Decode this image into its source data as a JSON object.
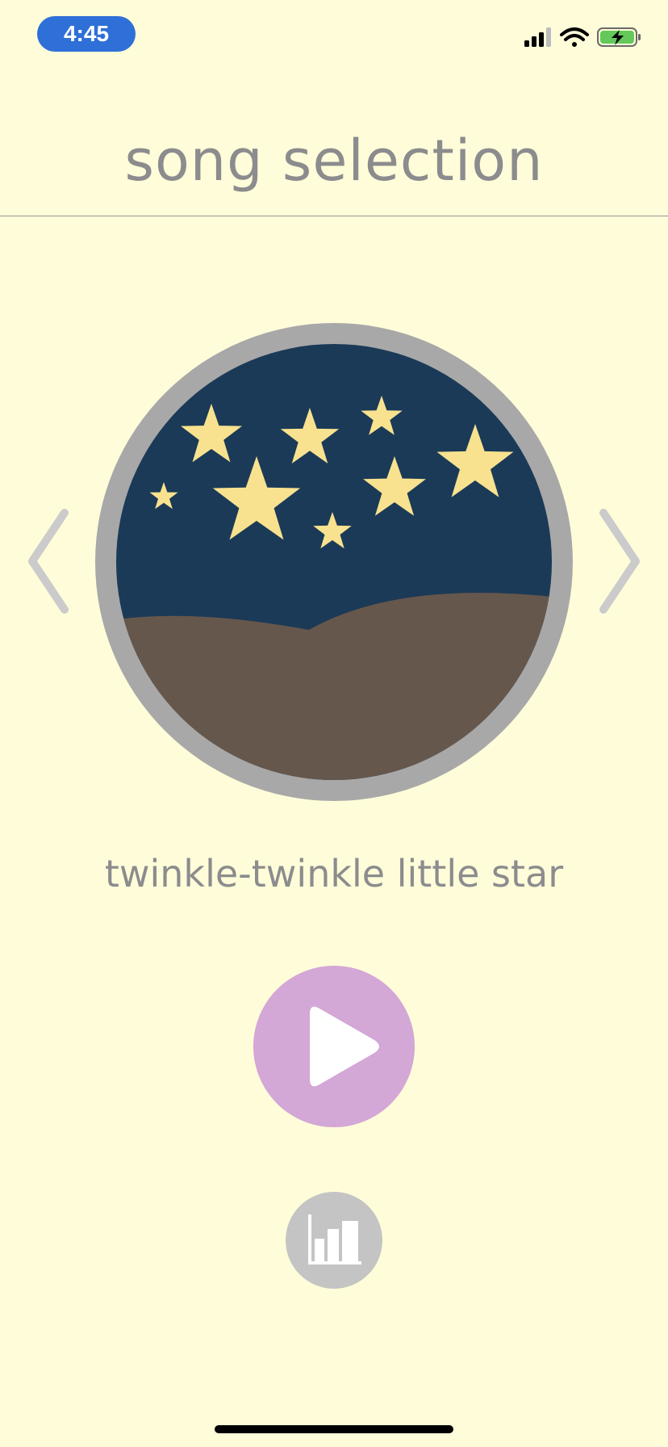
{
  "status_bar": {
    "time": "4:45",
    "icons": [
      "cellular-signal-icon",
      "wifi-icon",
      "battery-charging-icon"
    ]
  },
  "header": {
    "title": "song selection"
  },
  "carousel": {
    "current_song": "twinkle-twinkle little star",
    "artwork": "night-sky-stars-icon",
    "prev_icon": "chevron-left-icon",
    "next_icon": "chevron-right-icon"
  },
  "controls": {
    "play_icon": "play-icon",
    "stats_icon": "bar-chart-icon"
  },
  "colors": {
    "background": "#fffdd9",
    "title_text": "#8c8c8e",
    "time_pill": "#2f6fd8",
    "artwork_ring": "#a8a8a8",
    "night_sky": "#1b3a57",
    "hills": "#66574c",
    "stars": "#f8e28f",
    "play_button": "#d3a7d6",
    "stats_button": "#c4c4c4",
    "arrows": "#cbcbcb"
  }
}
